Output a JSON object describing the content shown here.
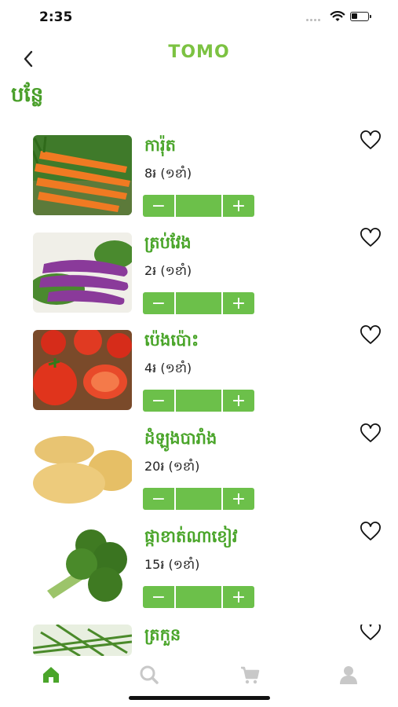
{
  "status": {
    "time": "2:35",
    "battery_level": 0.35
  },
  "header": {
    "logo": "TOMO"
  },
  "page": {
    "title": "បន្លែ"
  },
  "products": [
    {
      "name": "ការ៉ុត",
      "price": "8៛ (១ខាំ)",
      "qty": ""
    },
    {
      "name": "ត្រប់វែង",
      "price": "2៛ (១ខាំ)",
      "qty": ""
    },
    {
      "name": "ប៉េងប៉ោះ",
      "price": "4៛ (១ខាំ)",
      "qty": ""
    },
    {
      "name": "ដំឡូងបារាំង",
      "price": "20៛ (១ខាំ)",
      "qty": ""
    },
    {
      "name": "ផ្កាខាត់ណាខៀវ",
      "price": "15៛ (១ខាំ)",
      "qty": ""
    },
    {
      "name": "ត្រកួន",
      "price": "",
      "qty": ""
    }
  ],
  "stepper": {
    "minus": "−",
    "plus": "+"
  },
  "tabbar": {
    "active": "home"
  },
  "colors": {
    "brand": "#4aa52a",
    "stepper": "#6cc04a",
    "tab_active": "#4aa52a",
    "tab_inactive": "#c8c8c8"
  }
}
